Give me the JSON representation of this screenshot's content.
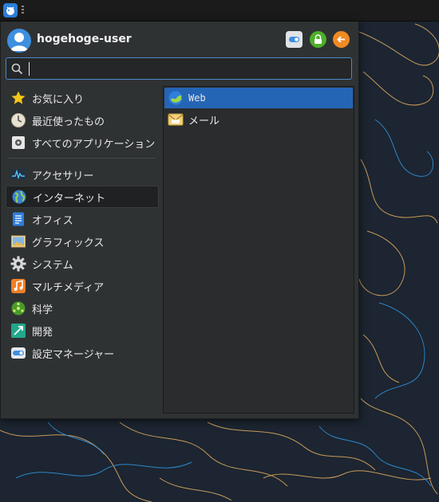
{
  "panel": {
    "menu_button_icon": "whisker-menu-icon"
  },
  "colors": {
    "accent": "#2565b5",
    "menu_bg": "#2f3233",
    "search_border": "#4a89c8",
    "lock_btn": "#4caf2a",
    "logout_btn": "#f08a24"
  },
  "header": {
    "username": "hogehoge-user",
    "buttons": [
      {
        "icon": "settings-toggle-icon"
      },
      {
        "icon": "lock-screen-icon"
      },
      {
        "icon": "log-out-icon"
      }
    ]
  },
  "search": {
    "value": "",
    "placeholder": ""
  },
  "categories": [
    {
      "label": "お気に入り",
      "icon": "star-icon"
    },
    {
      "label": "最近使ったもの",
      "icon": "clock-icon"
    },
    {
      "label": "すべてのアプリケーション",
      "icon": "applications-icon"
    },
    {
      "label": "アクセサリー",
      "icon": "accessories-icon"
    },
    {
      "label": "インターネット",
      "icon": "globe-icon",
      "active": true
    },
    {
      "label": "オフィス",
      "icon": "office-icon"
    },
    {
      "label": "グラフィックス",
      "icon": "graphics-icon"
    },
    {
      "label": "システム",
      "icon": "system-gear-icon"
    },
    {
      "label": "マルチメディア",
      "icon": "music-icon"
    },
    {
      "label": "科学",
      "icon": "science-icon"
    },
    {
      "label": "開発",
      "icon": "development-icon"
    },
    {
      "label": "設定マネージャー",
      "icon": "settings-manager-icon"
    }
  ],
  "apps": [
    {
      "label": "Web",
      "icon": "web-browser-icon",
      "selected": true
    },
    {
      "label": "メール",
      "icon": "mail-icon"
    }
  ]
}
